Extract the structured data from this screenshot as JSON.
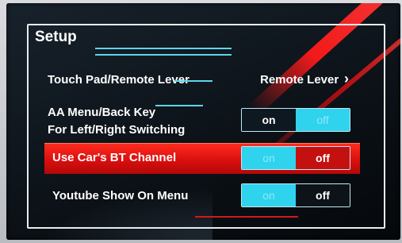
{
  "screen": {
    "title": "Setup",
    "accent": "#2fd3ee",
    "highlight_color": "#d90f0f"
  },
  "rows": [
    {
      "label": "Touch Pad/Remote Lever",
      "value": "Remote Lever",
      "icon": "chevron-right-icon"
    },
    {
      "label_line1": "AA Menu/Back Key",
      "label_line2": "For Left/Right Switching",
      "on": "on",
      "off": "off",
      "selected": "on"
    },
    {
      "label": "Use Car's BT Channel",
      "on": "on",
      "off": "off",
      "selected": "off",
      "highlighted": true
    },
    {
      "label": "Youtube Show On Menu",
      "on": "on",
      "off": "off",
      "selected": "off"
    }
  ]
}
